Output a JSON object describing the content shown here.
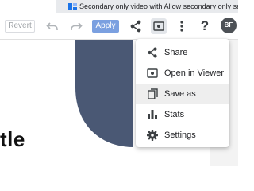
{
  "tab": {
    "title": "Secondary only video with Allow secondary only sel..."
  },
  "toolbar": {
    "revert_label": "Revert",
    "apply_label": "Apply",
    "help_label": "?",
    "avatar_initials": "BF"
  },
  "menu": {
    "items": [
      {
        "label": "Share",
        "icon": "share-icon"
      },
      {
        "label": "Open in Viewer",
        "icon": "viewer-icon"
      },
      {
        "label": "Save as",
        "icon": "copy-icon",
        "highlighted": true
      },
      {
        "label": "Stats",
        "icon": "bar-chart-icon"
      },
      {
        "label": "Settings",
        "icon": "gear-icon"
      }
    ]
  },
  "canvas": {
    "title_fragment": "tle"
  },
  "colors": {
    "accent": "#7ba0e0",
    "shape": "#4a5874",
    "avatar": "#4d5156"
  }
}
